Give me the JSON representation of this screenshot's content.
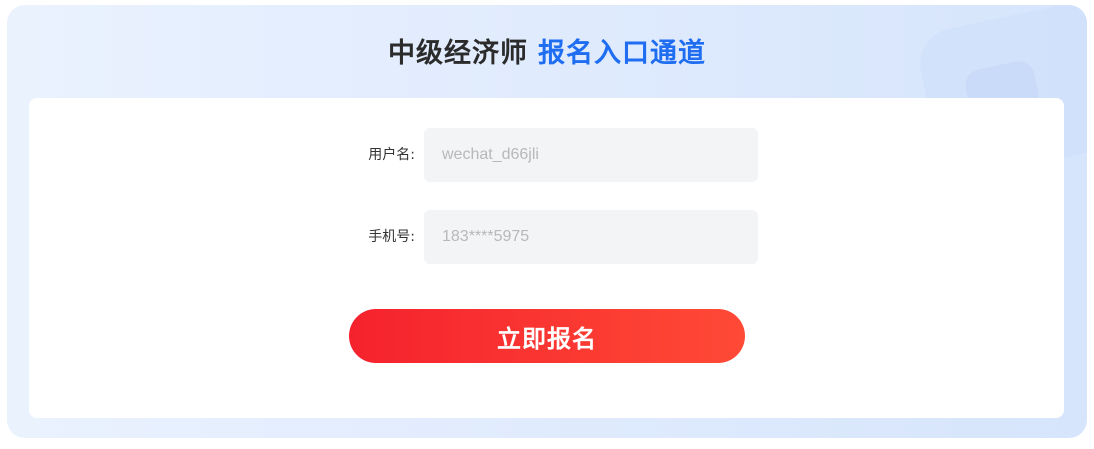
{
  "header": {
    "title_main": "中级经济师",
    "title_accent": "报名入口通道"
  },
  "form": {
    "username": {
      "label": "用户名:",
      "placeholder": "wechat_d66jli"
    },
    "phone": {
      "label": "手机号:",
      "placeholder": "183****5975"
    },
    "submit_label": "立即报名"
  },
  "colors": {
    "accent": "#1f6ef2",
    "title": "#2b2b2b",
    "button_start": "#f5222d",
    "button_end": "#ff4a36",
    "panel_bg": "#e3edfd",
    "input_bg": "#f3f4f6"
  }
}
